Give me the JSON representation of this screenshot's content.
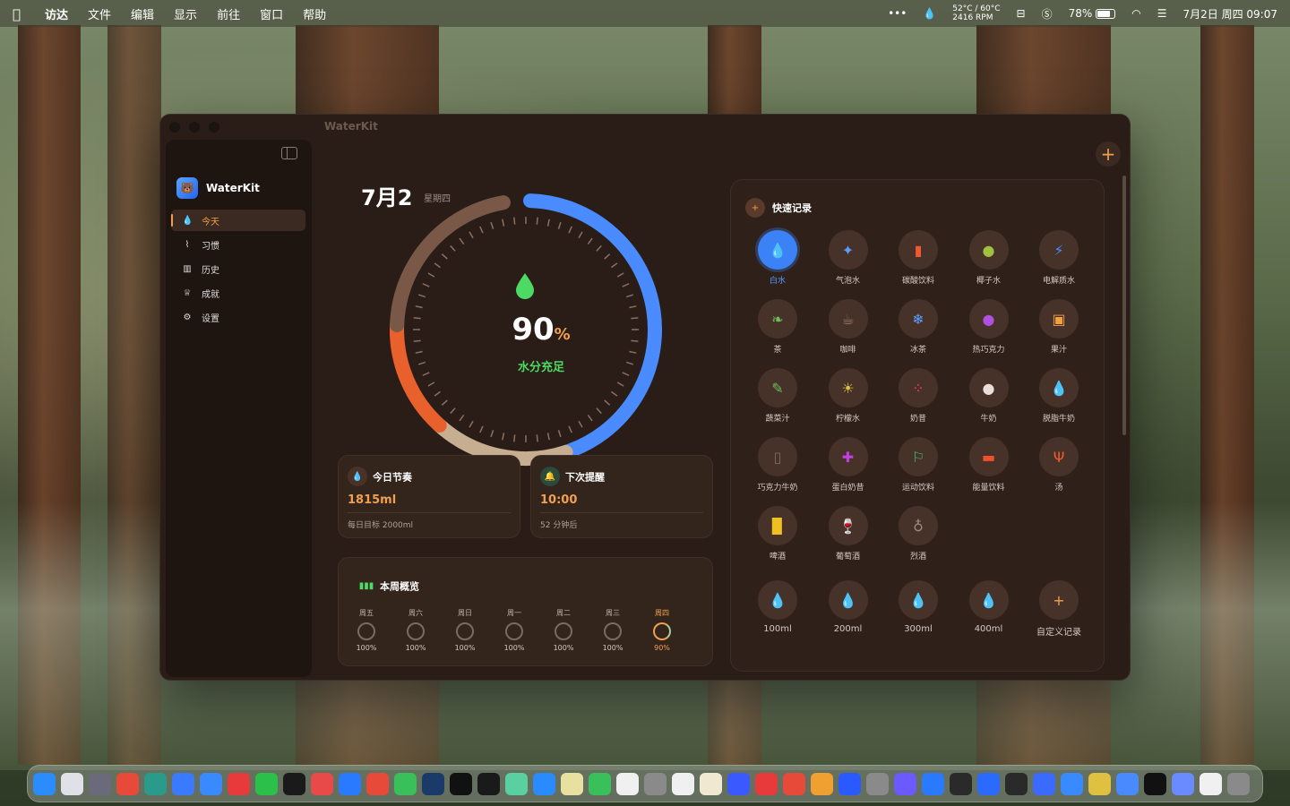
{
  "menubar": {
    "app": "访达",
    "items": [
      "文件",
      "编辑",
      "显示",
      "前往",
      "窗口",
      "帮助"
    ],
    "temp": "52°C / 60°C",
    "rpm": "2416 RPM",
    "battery": "78%",
    "datetime": "7月2日 周四 09:07"
  },
  "window": {
    "title": "WaterKit"
  },
  "sidebar": {
    "brand": "WaterKit",
    "items": [
      {
        "label": "今天",
        "icon": "drop-icon"
      },
      {
        "label": "习惯",
        "icon": "chart-line-icon"
      },
      {
        "label": "历史",
        "icon": "bar-chart-icon"
      },
      {
        "label": "成就",
        "icon": "trophy-icon"
      },
      {
        "label": "设置",
        "icon": "gear-icon"
      }
    ]
  },
  "today": {
    "date": "7月2",
    "weekday": "星期四",
    "percent": "90",
    "percent_unit": "%",
    "status": "水分充足",
    "ring_fraction": 0.9
  },
  "rhythm": {
    "title": "今日节奏",
    "value": "1815ml",
    "goal": "每日目标 2000ml"
  },
  "reminder": {
    "title": "下次提醒",
    "time": "10:00",
    "countdown": "52 分钟后"
  },
  "week": {
    "title": "本周概览",
    "days": [
      {
        "day": "周五",
        "pct": "100%"
      },
      {
        "day": "周六",
        "pct": "100%"
      },
      {
        "day": "周日",
        "pct": "100%"
      },
      {
        "day": "周一",
        "pct": "100%"
      },
      {
        "day": "周二",
        "pct": "100%"
      },
      {
        "day": "周三",
        "pct": "100%"
      },
      {
        "day": "周四",
        "pct": "90%"
      }
    ]
  },
  "quick": {
    "title": "快速记录",
    "drinks": [
      {
        "label": "白水",
        "glyph": "💧",
        "color": "#3a82f6"
      },
      {
        "label": "气泡水",
        "glyph": "✦",
        "color": "#5a9cff"
      },
      {
        "label": "碳酸饮料",
        "glyph": "▮",
        "color": "#f05a30"
      },
      {
        "label": "椰子水",
        "glyph": "●",
        "color": "#a0c040"
      },
      {
        "label": "电解质水",
        "glyph": "⚡",
        "color": "#4a8cff"
      },
      {
        "label": "茶",
        "glyph": "❧",
        "color": "#6cbf5a"
      },
      {
        "label": "咖啡",
        "glyph": "☕",
        "color": "#9a7a6a"
      },
      {
        "label": "冰茶",
        "glyph": "❄",
        "color": "#5aa0ff"
      },
      {
        "label": "热巧克力",
        "glyph": "●",
        "color": "#b050e0"
      },
      {
        "label": "果汁",
        "glyph": "▣",
        "color": "#f0a040"
      },
      {
        "label": "蔬菜汁",
        "glyph": "✎",
        "color": "#6cbf5a"
      },
      {
        "label": "柠檬水",
        "glyph": "☀",
        "color": "#e0c040"
      },
      {
        "label": "奶昔",
        "glyph": "⁘",
        "color": "#f04060"
      },
      {
        "label": "牛奶",
        "glyph": "●",
        "color": "#e8e0d8"
      },
      {
        "label": "脱脂牛奶",
        "glyph": "💧",
        "color": "#b0a8a0"
      },
      {
        "label": "巧克力牛奶",
        "glyph": "▯",
        "color": "#7a6a60"
      },
      {
        "label": "蛋白奶昔",
        "glyph": "✚",
        "color": "#c040e0"
      },
      {
        "label": "运动饮料",
        "glyph": "⚐",
        "color": "#40c070"
      },
      {
        "label": "能量饮料",
        "glyph": "▬",
        "color": "#f05030"
      },
      {
        "label": "汤",
        "glyph": "Ψ",
        "color": "#f05a30"
      },
      {
        "label": "啤酒",
        "glyph": "▉",
        "color": "#f0c020"
      },
      {
        "label": "葡萄酒",
        "glyph": "🍷",
        "color": "#a040c0"
      },
      {
        "label": "烈酒",
        "glyph": "♁",
        "color": "#9a8a80"
      }
    ],
    "amounts": [
      {
        "label": "100ml",
        "glyph": "💧",
        "color": "#3a82f6"
      },
      {
        "label": "200ml",
        "glyph": "💧",
        "color": "#3a82f6"
      },
      {
        "label": "300ml",
        "glyph": "💧",
        "color": "#3a82f6"
      },
      {
        "label": "400ml",
        "glyph": "💧",
        "color": "#3a82f6"
      },
      {
        "label": "自定义记录",
        "glyph": "+",
        "color": "#f0a050"
      }
    ]
  },
  "colors": {
    "accent": "#f0a050",
    "ring_blue": "#4a8cff",
    "ring_orange": "#e8602c",
    "ring_tan": "#c8ae90",
    "ring_brown": "#7a5848",
    "good": "#4cd964"
  }
}
